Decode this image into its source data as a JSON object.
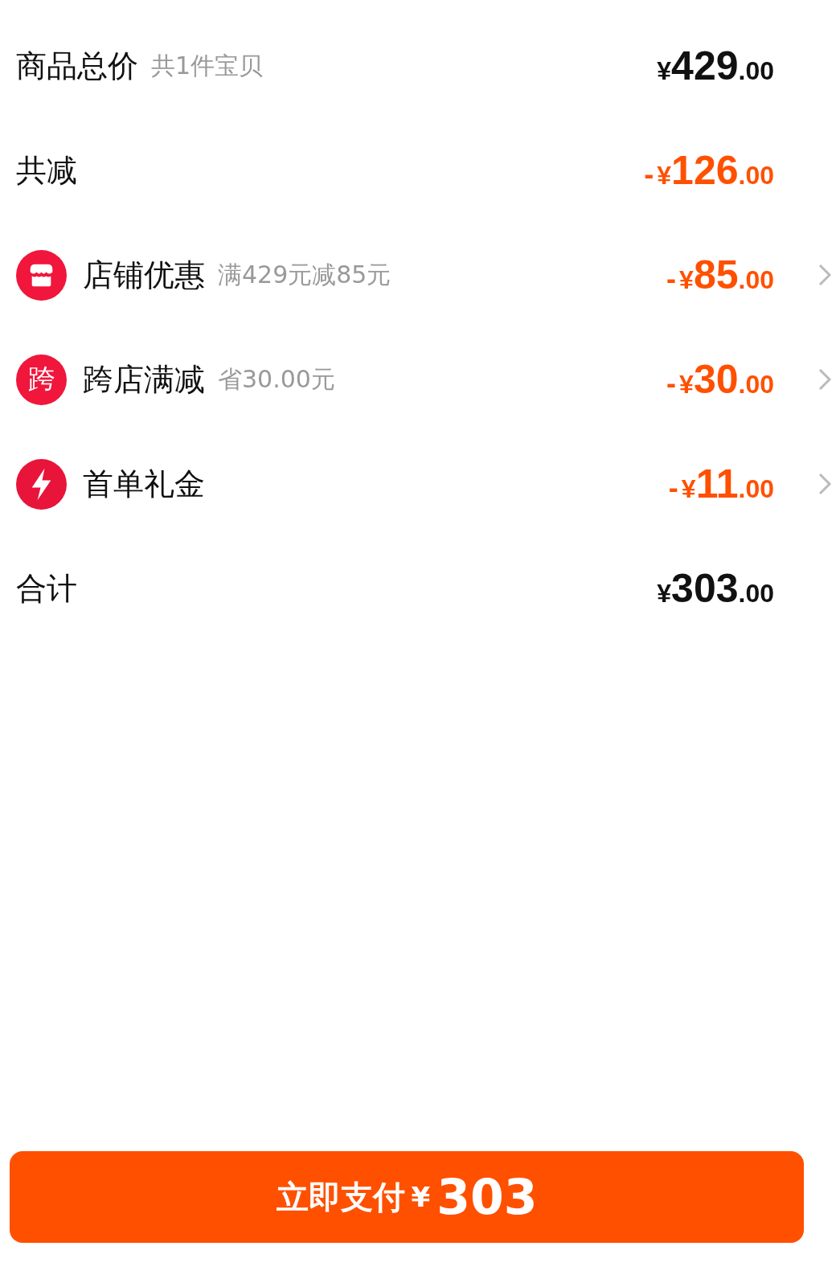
{
  "rows": [
    {
      "kind": "summary",
      "label": "商品总价",
      "hint": "共1件宝贝",
      "amount": {
        "currency": "¥",
        "integer": "429",
        "decimal": ".00"
      }
    },
    {
      "kind": "discount",
      "label": "共减",
      "amount": {
        "sign": "-",
        "currency": "¥",
        "integer": "126",
        "decimal": ".00"
      }
    },
    {
      "kind": "promo",
      "icon": {
        "kind": "store"
      },
      "label": "店铺优惠",
      "hint": "满429元减85元",
      "amount": {
        "sign": "-",
        "currency": "¥",
        "integer": "85",
        "decimal": ".00"
      }
    },
    {
      "kind": "promo",
      "icon": {
        "kind": "text",
        "text": "跨"
      },
      "label": "跨店满减",
      "hint": "省30.00元",
      "amount": {
        "sign": "-",
        "currency": "¥",
        "integer": "30",
        "decimal": ".00"
      }
    },
    {
      "kind": "promo",
      "icon": {
        "kind": "bolt"
      },
      "label": "首单礼金",
      "amount": {
        "sign": "-",
        "currency": "¥",
        "integer": "11",
        "decimal": ".00"
      }
    },
    {
      "kind": "summary",
      "label": "合计",
      "amount": {
        "currency": "¥",
        "integer": "303",
        "decimal": ".00"
      }
    }
  ],
  "pay_button": {
    "label": "立即支付",
    "currency": "¥",
    "amount": "303"
  }
}
